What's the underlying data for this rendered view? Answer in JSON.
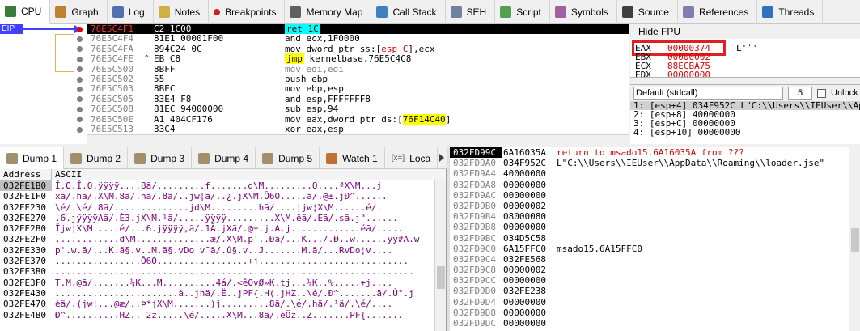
{
  "colors": {
    "accent": "#4040ff",
    "red": "#e00000",
    "hl_cyan": "#00ffff",
    "hl_yellow": "#ffff00",
    "box_red": "#e02020"
  },
  "tabs": [
    {
      "label": "CPU",
      "icon": "cpu-icon",
      "active": true
    },
    {
      "label": "Graph",
      "icon": "graph-icon"
    },
    {
      "label": "Log",
      "icon": "log-icon"
    },
    {
      "label": "Notes",
      "icon": "notes-icon"
    },
    {
      "label": "Breakpoints",
      "icon": "breakpoint-dot-icon"
    },
    {
      "label": "Memory Map",
      "icon": "memory-map-icon"
    },
    {
      "label": "Call Stack",
      "icon": "call-stack-icon"
    },
    {
      "label": "SEH",
      "icon": "seh-icon"
    },
    {
      "label": "Script",
      "icon": "script-icon"
    },
    {
      "label": "Symbols",
      "icon": "symbols-icon"
    },
    {
      "label": "Source",
      "icon": "source-icon"
    },
    {
      "label": "References",
      "icon": "references-icon"
    },
    {
      "label": "Threads",
      "icon": "threads-icon"
    }
  ],
  "disasm": {
    "eip_label": "EIP",
    "rows": [
      {
        "addr": "76E5C4F1",
        "bytes": "C2 1C00",
        "inst": "ret 1C",
        "kind": "ret",
        "current": true
      },
      {
        "addr": "76E5C4F4",
        "bytes": "81E1 00001F00",
        "inst": "and ecx,1F0000"
      },
      {
        "addr": "76E5C4FA",
        "bytes": "894C24 0C",
        "inst_parts": [
          "mov dword ptr ss:[",
          "esp+C",
          "],ecx"
        ]
      },
      {
        "addr": "76E5C4FE",
        "bytes": "EB C8",
        "inst_parts": [
          "jmp",
          " kernelbase.76E5C4C8"
        ],
        "kind": "jmp",
        "jmpmark": "^"
      },
      {
        "addr": "76E5C500",
        "bytes": "8BFF",
        "inst": "mov edi,edi",
        "kind": "nop"
      },
      {
        "addr": "76E5C502",
        "bytes": "55",
        "inst": "push ebp"
      },
      {
        "addr": "76E5C503",
        "bytes": "8BEC",
        "inst": "mov ebp,esp"
      },
      {
        "addr": "76E5C505",
        "bytes": "83E4 F8",
        "inst": "and esp,FFFFFFF8"
      },
      {
        "addr": "76E5C508",
        "bytes": "81EC 94000000",
        "inst": "sub esp,94"
      },
      {
        "addr": "76E5C50E",
        "bytes": "A1 404CF176",
        "inst_parts": [
          "mov eax,dword ptr ds:[",
          "76F14C40",
          "]"
        ]
      },
      {
        "addr": "76E5C513",
        "bytes": "33C4",
        "inst": "xor eax,esp"
      }
    ]
  },
  "registers": {
    "header": "Hide FPU",
    "items": [
      {
        "name": "EAX",
        "value": "00000374",
        "extra": "L'ʹ'"
      },
      {
        "name": "EBX",
        "value": "00000002"
      },
      {
        "name": "ECX",
        "value": "88ECBA75"
      },
      {
        "name": "EDX",
        "value": "00000000"
      }
    ]
  },
  "callstack": {
    "convention": "Default (stdcall)",
    "count": "5",
    "unlock_label": "Unlock",
    "rows": [
      "1: [esp+4] 034F952C L\"C:\\\\Users\\\\IEUser\\\\Ap",
      "2: [esp+8] 40000000",
      "3: [esp+C] 00000000",
      "4: [esp+10] 00000000"
    ]
  },
  "dumptabs": [
    {
      "label": "Dump 1",
      "active": true
    },
    {
      "label": "Dump 2"
    },
    {
      "label": "Dump 3"
    },
    {
      "label": "Dump 4"
    },
    {
      "label": "Dump 5"
    },
    {
      "label": "Watch 1",
      "icon": "watch-icon"
    },
    {
      "label": "Loca",
      "prefix": "[x=]"
    }
  ],
  "dump": {
    "col_address": "Address",
    "col_ascii": "ASCII",
    "rows": [
      {
        "addr": "032FE1B0",
        "text": "Ī.O.Ī.O.ÿÿÿÿ....8ã/.........f.......d\\M.........O....ªX\\M...j"
      },
      {
        "addr": "032FE1F0",
        "text": "xã/.hã/.X\\M.8ã/.hã/.8ã/..jw¦ã/..¿.jX\\M.Ô6O.....ä/.@±.jÐ^......"
      },
      {
        "addr": "032FE230",
        "text": "\\é/.\\é/.8ã/..............jd\\M.........hã/....|jw¦X\\M......é/."
      },
      {
        "addr": "032FE270",
        "text": ".6.jÿÿÿÿAã/.È3.jX\\M.¹ã/.....ÿÿÿÿ.........X\\M.êã/.Èã/.sã.j\"......"
      },
      {
        "addr": "032FE2B0",
        "text": "Ījw¦X\\M.....é/...6.jÿÿÿÿ,ã/.1Ã.jXã/.@±.j.A.j.............éã/....."
      },
      {
        "addr": "032FE2F0",
        "text": "............d\\M..............æ/.X\\M.p'..Ðã/...K.../.Ð..w......ÿÿ#A.w"
      },
      {
        "addr": "032FE330",
        "text": "p'.w.ã/...K.ã§.v..M.ã§.vDo¦v¯ã/.û§.v..J.......M.ã/...RvDo¦v...."
      },
      {
        "addr": "032FE370",
        "text": "................Ô6O.................+j............................"
      },
      {
        "addr": "032FE3B0",
        "text": "..................................................................."
      },
      {
        "addr": "032FE3F0",
        "text": "T.M.@ã/.......¼K...M..........4á/.<êQvØ»K.tj...¼K..%.....+j...."
      },
      {
        "addr": "032FE430",
        "text": ".......................à..jhä/.Ë..jPF{.H(.jHZ..\\é/.Ð^.......ä/.Ù°.j"
      },
      {
        "addr": "032FE470",
        "text": "èä/.(jw¦...@æ/..Þ*jX\\M.......)j.........8ä/.\\é/.hä/.¹ä/.\\é/...."
      },
      {
        "addr": "032FE4B0",
        "text": "Ð^..........HZ..¨2z.....\\é/.....X\\M...8ä/.èÖz..Z.......PF{......."
      }
    ]
  },
  "stack": {
    "rows": [
      {
        "addr": "032FD99C",
        "val": "6A16035A",
        "comment": "return to msado15.6A16035A from ???",
        "current": true
      },
      {
        "addr": "032FD9A0",
        "val": "034F952C",
        "comment": "L\"C:\\\\Users\\\\IEUser\\\\AppData\\\\Roaming\\\\loader.jse\""
      },
      {
        "addr": "032FD9A4",
        "val": "40000000",
        "comment": ""
      },
      {
        "addr": "032FD9A8",
        "val": "00000000",
        "comment": ""
      },
      {
        "addr": "032FD9AC",
        "val": "00000000",
        "comment": ""
      },
      {
        "addr": "032FD9B0",
        "val": "00000002",
        "comment": ""
      },
      {
        "addr": "032FD9B4",
        "val": "08000080",
        "comment": ""
      },
      {
        "addr": "032FD9B8",
        "val": "00000000",
        "comment": ""
      },
      {
        "addr": "032FD9BC",
        "val": "034D5C58",
        "comment": ""
      },
      {
        "addr": "032FD9C0",
        "val": "6A15FFC0",
        "comment": "msado15.6A15FFC0"
      },
      {
        "addr": "032FD9C4",
        "val": "032FE568",
        "comment": ""
      },
      {
        "addr": "032FD9C8",
        "val": "00000002",
        "comment": ""
      },
      {
        "addr": "032FD9CC",
        "val": "00000000",
        "comment": ""
      },
      {
        "addr": "032FD9D0",
        "val": "032FE238",
        "comment": ""
      },
      {
        "addr": "032FD9D4",
        "val": "00000000",
        "comment": ""
      },
      {
        "addr": "032FD9D8",
        "val": "00000000",
        "comment": ""
      },
      {
        "addr": "032FD9DC",
        "val": "00000000",
        "comment": ""
      }
    ]
  }
}
